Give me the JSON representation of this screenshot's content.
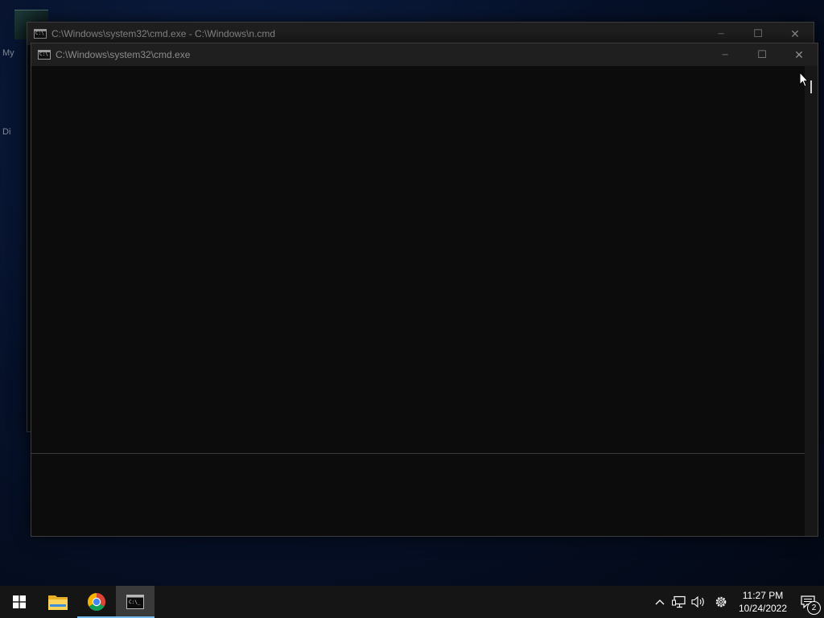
{
  "desktop": {
    "icon_label_1": "My",
    "icon_label_2": "Di"
  },
  "windows": {
    "back": {
      "title": "C:\\Windows\\system32\\cmd.exe - C:\\Windows\\n.cmd",
      "controls": {
        "minimize": "─",
        "maximize": "☐",
        "close": "✕"
      }
    },
    "front": {
      "title": "C:\\Windows\\system32\\cmd.exe",
      "controls": {
        "minimize": "─",
        "maximize": "☐",
        "close": "✕"
      }
    }
  },
  "taskbar": {
    "apps": [
      "start",
      "file-explorer",
      "chrome",
      "command-prompt"
    ],
    "clock": {
      "time": "11:27 PM",
      "date": "10/24/2022"
    },
    "notifications": {
      "count": "2"
    }
  },
  "colors": {
    "accent": "#76b9ed",
    "console_bg": "#0c0c0c",
    "titlebar_bg": "#1f1f1f"
  }
}
